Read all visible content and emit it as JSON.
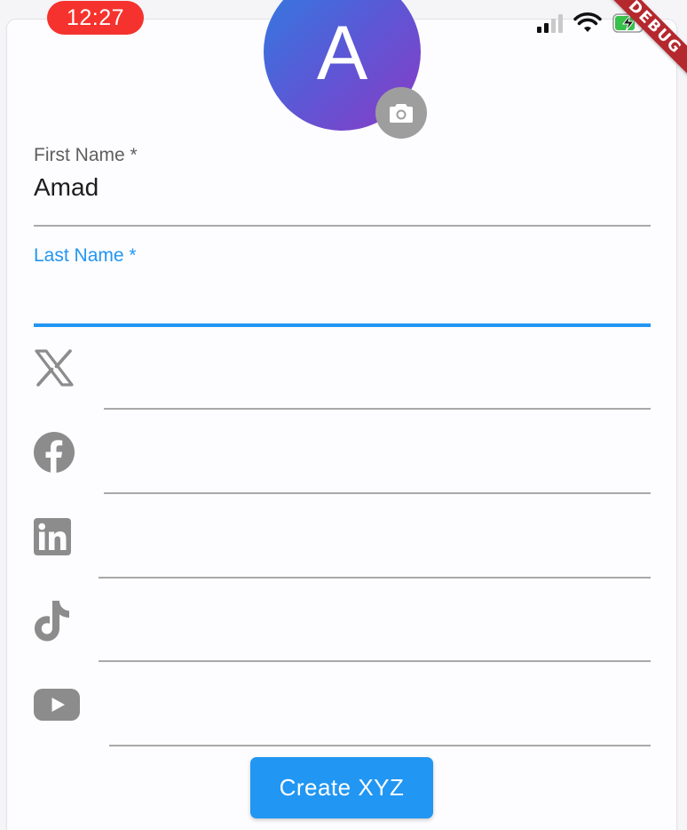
{
  "status_bar": {
    "time": "12:27",
    "debug_banner": "DEBUG"
  },
  "profile": {
    "avatar_initial": "A"
  },
  "form": {
    "first_name": {
      "label": "First Name *",
      "value": "Amad"
    },
    "last_name": {
      "label": "Last Name *",
      "value": ""
    },
    "social_fields": [
      {
        "icon": "x-twitter-icon",
        "value": ""
      },
      {
        "icon": "facebook-icon",
        "value": ""
      },
      {
        "icon": "linkedin-icon",
        "value": ""
      },
      {
        "icon": "tiktok-icon",
        "value": ""
      },
      {
        "icon": "youtube-icon",
        "value": ""
      }
    ],
    "submit_label": "Create XYZ"
  },
  "colors": {
    "accent": "#2196f3",
    "time_pill": "#f5322d",
    "icon_gray": "#8c8c8c",
    "debug_banner": "#b5282e"
  }
}
